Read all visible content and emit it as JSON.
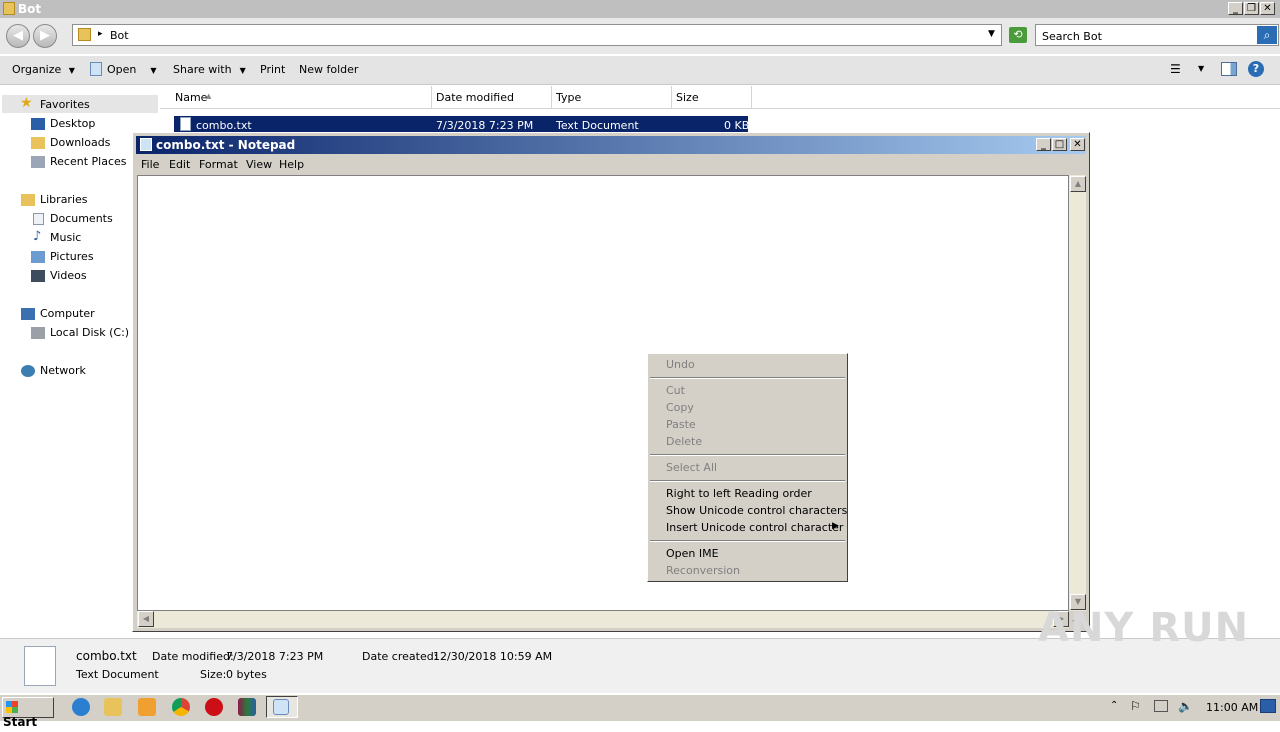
{
  "explorer": {
    "title": "Bot",
    "breadcrumb": "Bot",
    "search_placeholder": "Search Bot",
    "toolbar": {
      "organize": "Organize",
      "open": "Open",
      "share_with": "Share with",
      "print": "Print",
      "new_folder": "New folder"
    },
    "nav": {
      "favorites": "Favorites",
      "desktop": "Desktop",
      "downloads": "Downloads",
      "recent_places": "Recent Places",
      "libraries": "Libraries",
      "documents": "Documents",
      "music": "Music",
      "pictures": "Pictures",
      "videos": "Videos",
      "computer": "Computer",
      "local_disk": "Local Disk (C:)",
      "network": "Network"
    },
    "columns": {
      "name": "Name",
      "date_modified": "Date modified",
      "type": "Type",
      "size": "Size"
    },
    "files": [
      {
        "name": "combo.txt",
        "date_modified": "7/3/2018 7:23 PM",
        "type": "Text Document",
        "size": "0 KB"
      }
    ],
    "details": {
      "filename": "combo.txt",
      "filetype": "Text Document",
      "date_modified_label": "Date modified:",
      "date_modified_value": "7/3/2018 7:23 PM",
      "date_created_label": "Date created:",
      "date_created_value": "12/30/2018 10:59 AM",
      "size_label": "Size:",
      "size_value": "0 bytes"
    }
  },
  "notepad": {
    "title": "combo.txt - Notepad",
    "menus": [
      "File",
      "Edit",
      "Format",
      "View",
      "Help"
    ]
  },
  "context_menu": {
    "undo": "Undo",
    "cut": "Cut",
    "copy": "Copy",
    "paste": "Paste",
    "delete": "Delete",
    "select_all": "Select All",
    "rtl": "Right to left Reading order",
    "show_unicode": "Show Unicode control characters",
    "insert_unicode": "Insert Unicode control character",
    "open_ime": "Open IME",
    "reconversion": "Reconversion"
  },
  "taskbar": {
    "start": "Start",
    "clock": "11:00 AM"
  },
  "watermark": "ANY RUN",
  "colors": {
    "selection": "#0a246a",
    "notepad_title_start": "#0a246a",
    "notepad_title_end": "#a6caf0"
  }
}
